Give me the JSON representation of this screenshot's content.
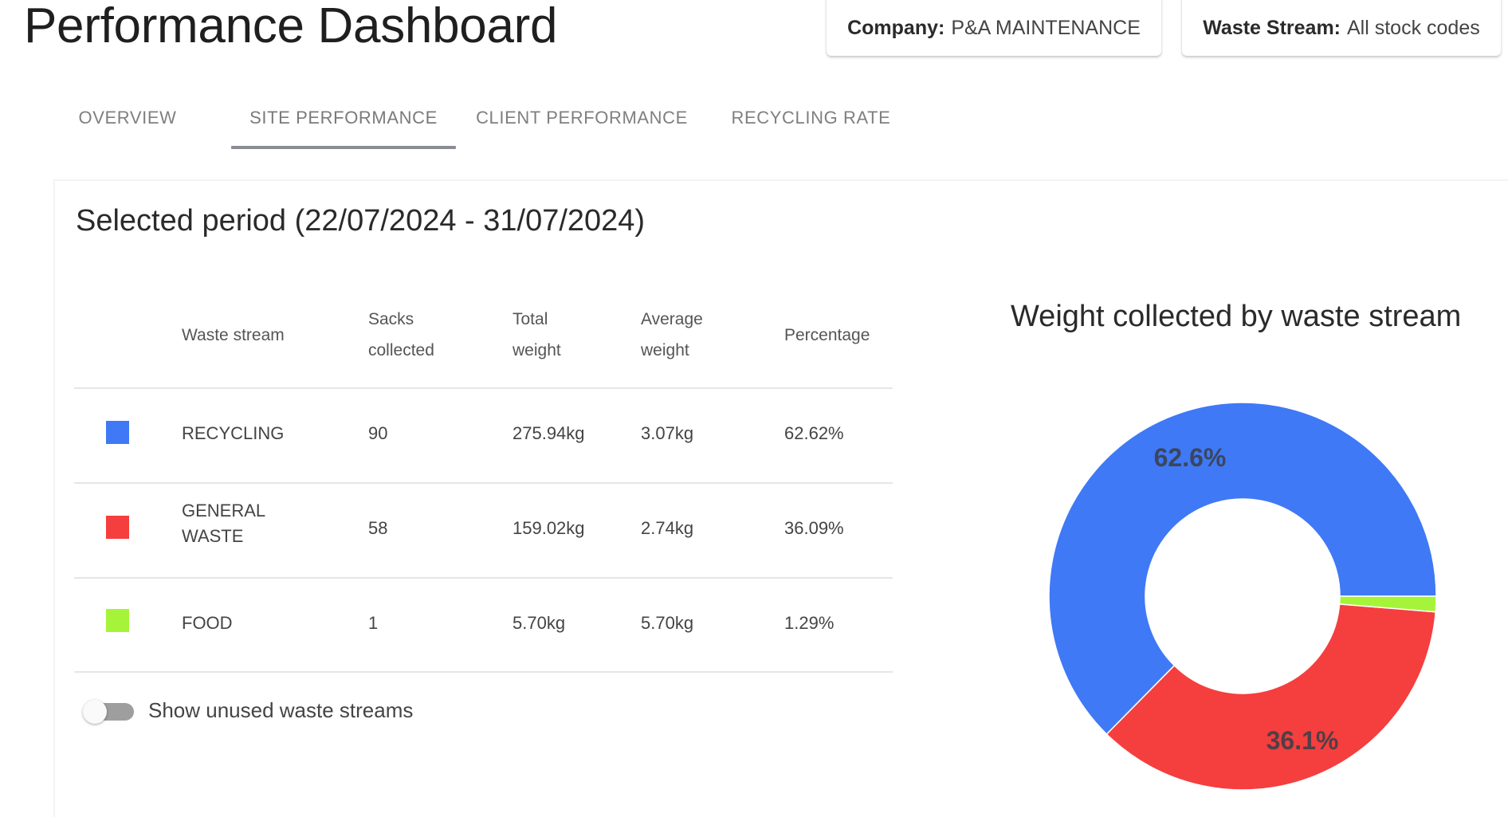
{
  "header": {
    "title": "Performance Dashboard",
    "filters": [
      {
        "key": "Company:",
        "value": "P&A MAINTENANCE"
      },
      {
        "key": "Waste Stream:",
        "value": "All stock codes"
      }
    ]
  },
  "tabs": [
    {
      "label": "OVERVIEW",
      "active": false
    },
    {
      "label": "SITE PERFORMANCE",
      "active": true
    },
    {
      "label": "CLIENT PERFORMANCE",
      "active": false
    },
    {
      "label": "RECYCLING RATE",
      "active": false
    }
  ],
  "period": {
    "title": "Selected period (22/07/2024 - 31/07/2024)"
  },
  "table": {
    "headers": {
      "waste_stream": "Waste stream",
      "sacks_1": "Sacks",
      "sacks_2": "collected",
      "total_1": "Total",
      "total_2": "weight",
      "avg_1": "Average",
      "avg_2": "weight",
      "percentage": "Percentage"
    },
    "rows": [
      {
        "name_1": "RECYCLING",
        "name_2": "",
        "color": "#3f79f5",
        "sacks": "90",
        "total": "275.94kg",
        "average": "3.07kg",
        "percentage": "62.62%"
      },
      {
        "name_1": "GENERAL",
        "name_2": "WASTE",
        "color": "#f53e3e",
        "sacks": "58",
        "total": "159.02kg",
        "average": "2.74kg",
        "percentage": "36.09%"
      },
      {
        "name_1": "FOOD",
        "name_2": "",
        "color": "#a6f43a",
        "sacks": "1",
        "total": "5.70kg",
        "average": "5.70kg",
        "percentage": "1.29%"
      }
    ]
  },
  "toggle": {
    "label": "Show unused waste streams",
    "checked": false
  },
  "chart_data": {
    "type": "pie",
    "variant": "donut",
    "title": "Weight collected by waste stream",
    "categories": [
      "RECYCLING",
      "GENERAL WASTE",
      "FOOD"
    ],
    "values": [
      275.94,
      159.02,
      5.7
    ],
    "percentages": [
      62.62,
      36.09,
      1.29
    ],
    "colors": [
      "#3f79f5",
      "#f53e3e",
      "#a6f43a"
    ],
    "data_labels": [
      "62.6%",
      "36.1%",
      ""
    ],
    "start_angle": "3 o'clock",
    "direction": "counterclockwise",
    "legend": "none"
  }
}
